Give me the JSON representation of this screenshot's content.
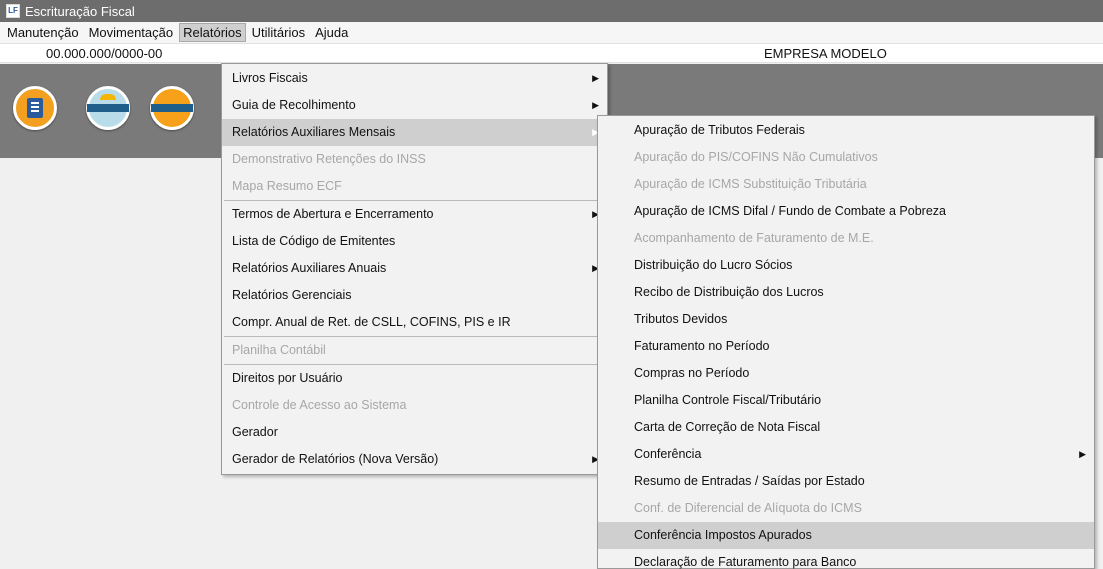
{
  "window": {
    "title": "Escrituração Fiscal",
    "icon": "app-icon"
  },
  "menubar": [
    "Manutenção",
    "Movimentação",
    "Relatórios",
    "Utilitários",
    "Ajuda"
  ],
  "infobar": {
    "cnpj": "00.000.000/0000-00",
    "company": "EMPRESA MODELO"
  },
  "toolbar": {
    "icons": [
      "building-icon",
      "sped-contribuicoes-icon",
      "sped-icon"
    ]
  },
  "relatorios_menu": [
    {
      "label": "Livros Fiscais",
      "submenu": true
    },
    {
      "label": "Guia de Recolhimento",
      "submenu": true
    },
    {
      "label": "Relatórios Auxiliares Mensais",
      "submenu": true,
      "highlighted": true
    },
    {
      "label": "Demonstrativo Retenções do INSS",
      "disabled": true
    },
    {
      "label": "Mapa Resumo ECF",
      "disabled": true
    },
    {
      "label": "Termos de Abertura e Encerramento",
      "submenu": true
    },
    {
      "label": "Lista de Código de Emitentes"
    },
    {
      "label": "Relatórios Auxiliares Anuais",
      "submenu": true
    },
    {
      "label": "Relatórios Gerenciais"
    },
    {
      "label": "Compr. Anual de Ret. de CSLL, COFINS,  PIS e IR"
    },
    {
      "label": "Planilha Contábil",
      "disabled": true
    },
    {
      "label": "Direitos por Usuário"
    },
    {
      "label": "Controle de Acesso ao Sistema",
      "disabled": true
    },
    {
      "label": "Gerador"
    },
    {
      "label": "Gerador de Relatórios (Nova Versão)",
      "submenu": true
    }
  ],
  "mensais_submenu": [
    {
      "label": "Apuração de Tributos Federais"
    },
    {
      "label": "Apuração do PIS/COFINS Não Cumulativos",
      "disabled": true
    },
    {
      "label": "Apuração de ICMS Substituição Tributária",
      "disabled": true
    },
    {
      "label": "Apuração de ICMS Difal / Fundo de Combate a Pobreza"
    },
    {
      "label": "Acompanhamento de Faturamento de M.E.",
      "disabled": true
    },
    {
      "label": "Distribuição do Lucro Sócios"
    },
    {
      "label": "Recibo de Distribuição dos Lucros"
    },
    {
      "label": "Tributos Devidos"
    },
    {
      "label": "Faturamento no Período"
    },
    {
      "label": "Compras no Período"
    },
    {
      "label": "Planilha Controle Fiscal/Tributário"
    },
    {
      "label": "Carta de Correção de Nota Fiscal"
    },
    {
      "label": "Conferência",
      "submenu": true
    },
    {
      "label": "Resumo de Entradas / Saídas por Estado"
    },
    {
      "label": "Conf. de Diferencial de Alíquota do ICMS",
      "disabled": true
    },
    {
      "label": "Conferência Impostos Apurados",
      "highlighted": true
    },
    {
      "label": "Declaração de Faturamento para Banco"
    }
  ],
  "colors": {
    "titlebar": "#6d6d6d",
    "toolbar": "#7a7a7a",
    "highlight": "#cfcfcf",
    "disabled": "#a7a7a7"
  }
}
